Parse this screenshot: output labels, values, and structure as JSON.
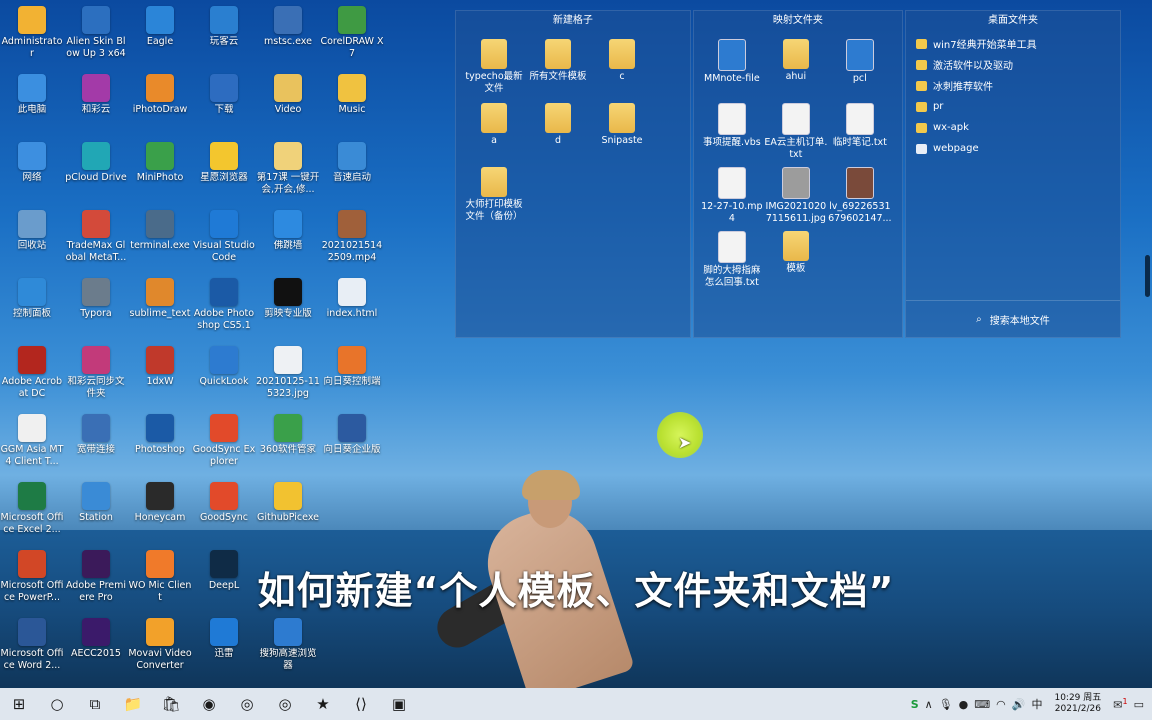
{
  "desktop_icons": [
    {
      "label": "Administrator",
      "icon": "user-folder-icon",
      "color": "#f2b233",
      "col": 0,
      "row": 0
    },
    {
      "label": "Alien Skin Blow Up 3 x64",
      "icon": "app-icon",
      "color": "#2c6fbf",
      "col": 1,
      "row": 0
    },
    {
      "label": "Eagle",
      "icon": "eagle-icon",
      "color": "#2b85d8",
      "col": 2,
      "row": 0
    },
    {
      "label": "玩客云",
      "icon": "cloud-icon",
      "color": "#2a7fd0",
      "col": 3,
      "row": 0
    },
    {
      "label": "mstsc.exe",
      "icon": "remote-desktop-icon",
      "color": "#3a6fb5",
      "col": 4,
      "row": 0
    },
    {
      "label": "CorelDRAW X7",
      "icon": "coreldraw-icon",
      "color": "#3f9a43",
      "col": 5,
      "row": 0
    },
    {
      "label": "此电脑",
      "icon": "computer-icon",
      "color": "#3b8fe0",
      "col": 0,
      "row": 1
    },
    {
      "label": "和彩云",
      "icon": "cloud-icon",
      "color": "#a33aa8",
      "col": 1,
      "row": 1
    },
    {
      "label": "iPhotoDraw",
      "icon": "photo-icon",
      "color": "#e98a2a",
      "col": 2,
      "row": 1
    },
    {
      "label": "下载",
      "icon": "download-icon",
      "color": "#2d6cc0",
      "col": 3,
      "row": 1
    },
    {
      "label": "Video",
      "icon": "folder-icon",
      "color": "#e9c25d",
      "col": 4,
      "row": 1
    },
    {
      "label": "Music",
      "icon": "folder-icon",
      "color": "#f0c240",
      "col": 5,
      "row": 1
    },
    {
      "label": "网络",
      "icon": "network-icon",
      "color": "#3d8fe0",
      "col": 0,
      "row": 2
    },
    {
      "label": "pCloud Drive",
      "icon": "cloud-icon",
      "color": "#21a7b5",
      "col": 1,
      "row": 2
    },
    {
      "label": "MiniPhoto",
      "icon": "photo-icon",
      "color": "#3aa04a",
      "col": 2,
      "row": 2
    },
    {
      "label": "星愿浏览器",
      "icon": "star-icon",
      "color": "#f3c62e",
      "col": 3,
      "row": 2
    },
    {
      "label": "第17课 一键开会,开会,修...",
      "icon": "folder-icon",
      "color": "#f0d27a",
      "col": 4,
      "row": 2
    },
    {
      "label": "音速启动",
      "icon": "launcher-icon",
      "color": "#3a8bd6",
      "col": 5,
      "row": 2
    },
    {
      "label": "回收站",
      "icon": "recycle-bin-icon",
      "color": "#6a9ccc",
      "col": 0,
      "row": 3
    },
    {
      "label": "TradeMax Global MetaT...",
      "icon": "app-icon",
      "color": "#d34a3a",
      "col": 1,
      "row": 3
    },
    {
      "label": "terminal.exe",
      "icon": "terminal-icon",
      "color": "#4a6b8a",
      "col": 2,
      "row": 3
    },
    {
      "label": "Visual Studio Code",
      "icon": "vscode-icon",
      "color": "#1f7ad6",
      "col": 3,
      "row": 3
    },
    {
      "label": "佛跳墙",
      "icon": "globe-icon",
      "color": "#2d8ae0",
      "col": 4,
      "row": 3
    },
    {
      "label": "20210215142509.mp4",
      "icon": "video-file-icon",
      "color": "#a0603a",
      "col": 5,
      "row": 3
    },
    {
      "label": "控制面板",
      "icon": "control-panel-icon",
      "color": "#2f8ad8",
      "col": 0,
      "row": 4
    },
    {
      "label": "Typora",
      "icon": "typora-icon",
      "color": "#6b7c8c",
      "col": 1,
      "row": 4
    },
    {
      "label": "sublime_text",
      "icon": "sublime-icon",
      "color": "#e0882c",
      "col": 2,
      "row": 4
    },
    {
      "label": "Adobe Photoshop CS5.1",
      "icon": "photoshop-icon",
      "color": "#1b5aa6",
      "col": 3,
      "row": 4
    },
    {
      "label": "剪映专业版",
      "icon": "capcut-icon",
      "color": "#111111",
      "col": 4,
      "row": 4
    },
    {
      "label": "index.html",
      "icon": "html-file-icon",
      "color": "#e8eef5",
      "col": 5,
      "row": 4
    },
    {
      "label": "Adobe Acrobat DC",
      "icon": "acrobat-icon",
      "color": "#b3261e",
      "col": 0,
      "row": 5
    },
    {
      "label": "和彩云同步文件夹",
      "icon": "sync-folder-icon",
      "color": "#c23a7a",
      "col": 1,
      "row": 5
    },
    {
      "label": "1dxW",
      "icon": "app-icon",
      "color": "#c0392b",
      "col": 2,
      "row": 5
    },
    {
      "label": "QuickLook",
      "icon": "search-icon",
      "color": "#2d7bd0",
      "col": 3,
      "row": 5
    },
    {
      "label": "20210125-115323.jpg",
      "icon": "image-file-icon",
      "color": "#eef1f4",
      "col": 4,
      "row": 5
    },
    {
      "label": "向日葵控制端",
      "icon": "sunflower-icon",
      "color": "#e8742a",
      "col": 5,
      "row": 5
    },
    {
      "label": "GGM Asia MT4 Client T...",
      "icon": "app-icon",
      "color": "#f0f0f0",
      "col": 0,
      "row": 6
    },
    {
      "label": "宽带连接",
      "icon": "network-icon",
      "color": "#3a6fb5",
      "col": 1,
      "row": 6
    },
    {
      "label": "Photoshop",
      "icon": "photoshop-icon",
      "color": "#1b5aa6",
      "col": 2,
      "row": 6
    },
    {
      "label": "GoodSync Explorer",
      "icon": "goodsync-icon",
      "color": "#e24a2a",
      "col": 3,
      "row": 6
    },
    {
      "label": "360软件管家",
      "icon": "app-store-icon",
      "color": "#3aa04a",
      "col": 4,
      "row": 6
    },
    {
      "label": "向日葵企业版",
      "icon": "sunflower-icon",
      "color": "#2c5aa0",
      "col": 5,
      "row": 6
    },
    {
      "label": "Microsoft Office Excel 2...",
      "icon": "excel-icon",
      "color": "#1e7b45",
      "col": 0,
      "row": 7
    },
    {
      "label": "Station",
      "icon": "station-icon",
      "color": "#3a8bd6",
      "col": 1,
      "row": 7
    },
    {
      "label": "Honeycam",
      "icon": "honeycam-icon",
      "color": "#2a2a2a",
      "col": 2,
      "row": 7
    },
    {
      "label": "GoodSync",
      "icon": "goodsync-icon",
      "color": "#e24a2a",
      "col": 3,
      "row": 7
    },
    {
      "label": "GithubPicexe",
      "icon": "app-icon",
      "color": "#f2c230",
      "col": 4,
      "row": 7
    },
    {
      "label": "Microsoft Office PowerP...",
      "icon": "powerpoint-icon",
      "color": "#d24726",
      "col": 0,
      "row": 8
    },
    {
      "label": "Adobe Premiere Pro",
      "icon": "premiere-icon",
      "color": "#3b1a5a",
      "col": 1,
      "row": 8
    },
    {
      "label": "WO Mic Client",
      "icon": "mic-icon",
      "color": "#f07a2a",
      "col": 2,
      "row": 8
    },
    {
      "label": "DeepL",
      "icon": "deepl-icon",
      "color": "#0f2b46",
      "col": 3,
      "row": 8
    },
    {
      "label": "Microsoft Office Word 2...",
      "icon": "word-icon",
      "color": "#2b5797",
      "col": 0,
      "row": 9
    },
    {
      "label": "AECC2015",
      "icon": "aftereffects-icon",
      "color": "#3b1a6a",
      "col": 1,
      "row": 9
    },
    {
      "label": "Movavi Video Converter",
      "icon": "movavi-icon",
      "color": "#f2a12a",
      "col": 2,
      "row": 9
    },
    {
      "label": "迅雷",
      "icon": "thunder-icon",
      "color": "#1f7ad6",
      "col": 3,
      "row": 9
    },
    {
      "label": "搜狗高速浏览器",
      "icon": "browser-icon",
      "color": "#2d7bd0",
      "col": 4,
      "row": 9
    }
  ],
  "fences": {
    "new_fence": {
      "title": "新建格子",
      "items": [
        {
          "label": "typecho最新文件",
          "type": "folder"
        },
        {
          "label": "所有文件模板",
          "type": "folder"
        },
        {
          "label": "c",
          "type": "folder"
        },
        {
          "label": "a",
          "type": "folder"
        },
        {
          "label": "d",
          "type": "folder"
        },
        {
          "label": "Snipaste",
          "type": "folder"
        },
        {
          "label": "大师打印模板文件（备份）",
          "type": "folder"
        }
      ]
    },
    "mapped_folder": {
      "title": "映射文件夹",
      "items": [
        {
          "label": "MMnote-file",
          "type": "app"
        },
        {
          "label": "ahui",
          "type": "folder"
        },
        {
          "label": "pcl",
          "type": "app"
        },
        {
          "label": "事项提醒.vbs",
          "type": "doc"
        },
        {
          "label": "EA云主机订单.txt",
          "type": "doc"
        },
        {
          "label": "临时笔记.txt",
          "type": "doc"
        },
        {
          "label": "12-27-10.mp4",
          "type": "doc"
        },
        {
          "label": "IMG20210207115611.jpg",
          "type": "image"
        },
        {
          "label": "lv_69226531679602147...",
          "type": "video"
        },
        {
          "label": "脚的大拇指麻怎么回事.txt",
          "type": "doc"
        },
        {
          "label": "模板",
          "type": "folder"
        }
      ]
    },
    "desktop_folder": {
      "title": "桌面文件夹",
      "items": [
        {
          "label": "win7经典开始菜单工具",
          "type": "folder"
        },
        {
          "label": "激活软件以及驱动",
          "type": "folder"
        },
        {
          "label": "冰刺推荐软件",
          "type": "folder"
        },
        {
          "label": "pr",
          "type": "folder"
        },
        {
          "label": "wx-apk",
          "type": "folder"
        },
        {
          "label": "webpage",
          "type": "page"
        }
      ],
      "search_label": "搜索本地文件"
    }
  },
  "subtitle": "如何新建“个人模板、文件夹和文档”",
  "taskbar": {
    "apps": [
      {
        "name": "start-button",
        "glyph": "⊞"
      },
      {
        "name": "search-button",
        "glyph": "○"
      },
      {
        "name": "task-view-button",
        "glyph": "⧉"
      },
      {
        "name": "file-explorer-button",
        "glyph": "📁"
      },
      {
        "name": "store-button",
        "glyph": "🛍"
      },
      {
        "name": "edge-button",
        "glyph": "◉"
      },
      {
        "name": "chrome-button",
        "glyph": "◎"
      },
      {
        "name": "chrome-2-button",
        "glyph": "◎"
      },
      {
        "name": "star-browser-button",
        "glyph": "★"
      },
      {
        "name": "vscode-button",
        "glyph": "⟨⟩"
      },
      {
        "name": "remote-desktop-button",
        "glyph": "▣"
      }
    ],
    "clock_time": "10:29 周五",
    "clock_date": "2021/2/26",
    "notification_count": "1"
  }
}
